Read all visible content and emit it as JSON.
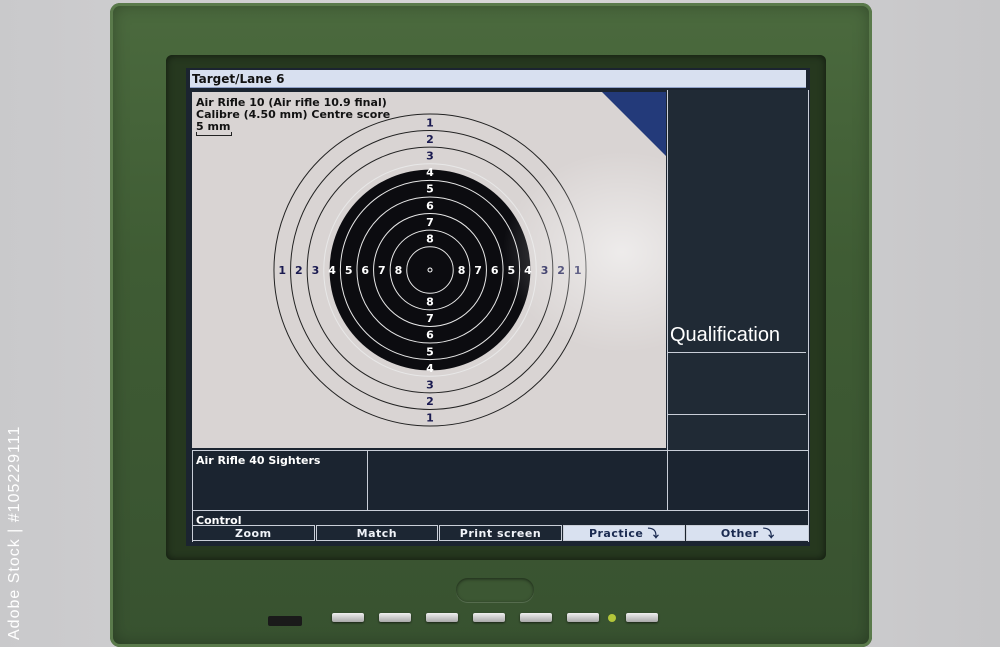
{
  "watermark_side_text": "Adobe Stock | #105229111",
  "window": {
    "title": "Target/Lane 6"
  },
  "target": {
    "line1": "Air Rifle 10 (Air rifle 10.9 final)",
    "line2": "Calibre (4.50 mm) Centre score",
    "scale_label": "5 mm",
    "ring_numbers": [
      "1",
      "2",
      "3",
      "4",
      "5",
      "6",
      "7",
      "8"
    ],
    "colors": {
      "paper": "#d9d4d3",
      "aiming_mark": "#0c0c10",
      "ring_line": "#222222",
      "corner": "#233a7a"
    }
  },
  "right_panel": {
    "mode_label": "Qualification"
  },
  "bottom": {
    "sighters_label": "Air Rifle 40 Sighters",
    "control_label": "Control"
  },
  "buttons": [
    {
      "label": "Zoom",
      "style": "dark"
    },
    {
      "label": "Match",
      "style": "dark"
    },
    {
      "label": "Print screen",
      "style": "dark"
    },
    {
      "label": "Practice ⤵",
      "style": "light"
    },
    {
      "label": "Other ⤵",
      "style": "light"
    }
  ],
  "device": {
    "bezel_color": "#41603a",
    "led_color": "#b3c63a",
    "hardware_button_count": 7
  }
}
